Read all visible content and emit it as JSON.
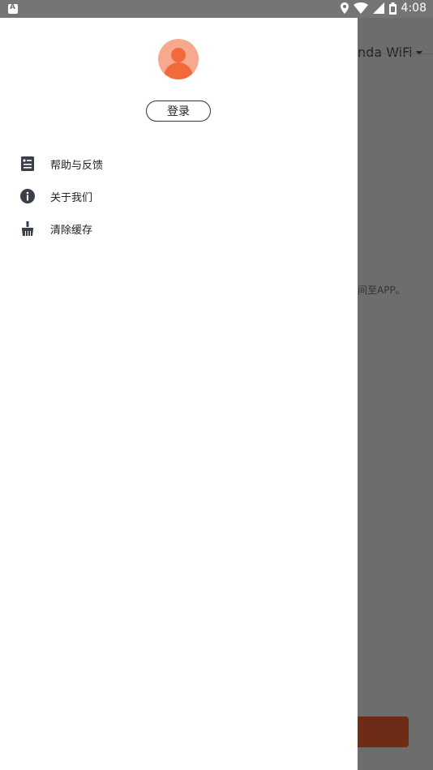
{
  "statusbar": {
    "time": "4:08",
    "icons": [
      "app-a-icon",
      "location-icon",
      "wifi-icon",
      "signal-icon",
      "battery-icon"
    ]
  },
  "background_app": {
    "title": "nda WiFi",
    "text": "间至APP。"
  },
  "drawer": {
    "login_label": "登录",
    "menu": [
      {
        "label": "帮助与反馈",
        "icon": "help-feedback-icon"
      },
      {
        "label": "关于我们",
        "icon": "info-icon"
      },
      {
        "label": "清除缓存",
        "icon": "broom-icon"
      }
    ]
  },
  "colors": {
    "accent": "#f26a3a",
    "avatar_bg": "#f6a98f",
    "overlay": "#6d6d6d",
    "statusbar": "#757575"
  }
}
